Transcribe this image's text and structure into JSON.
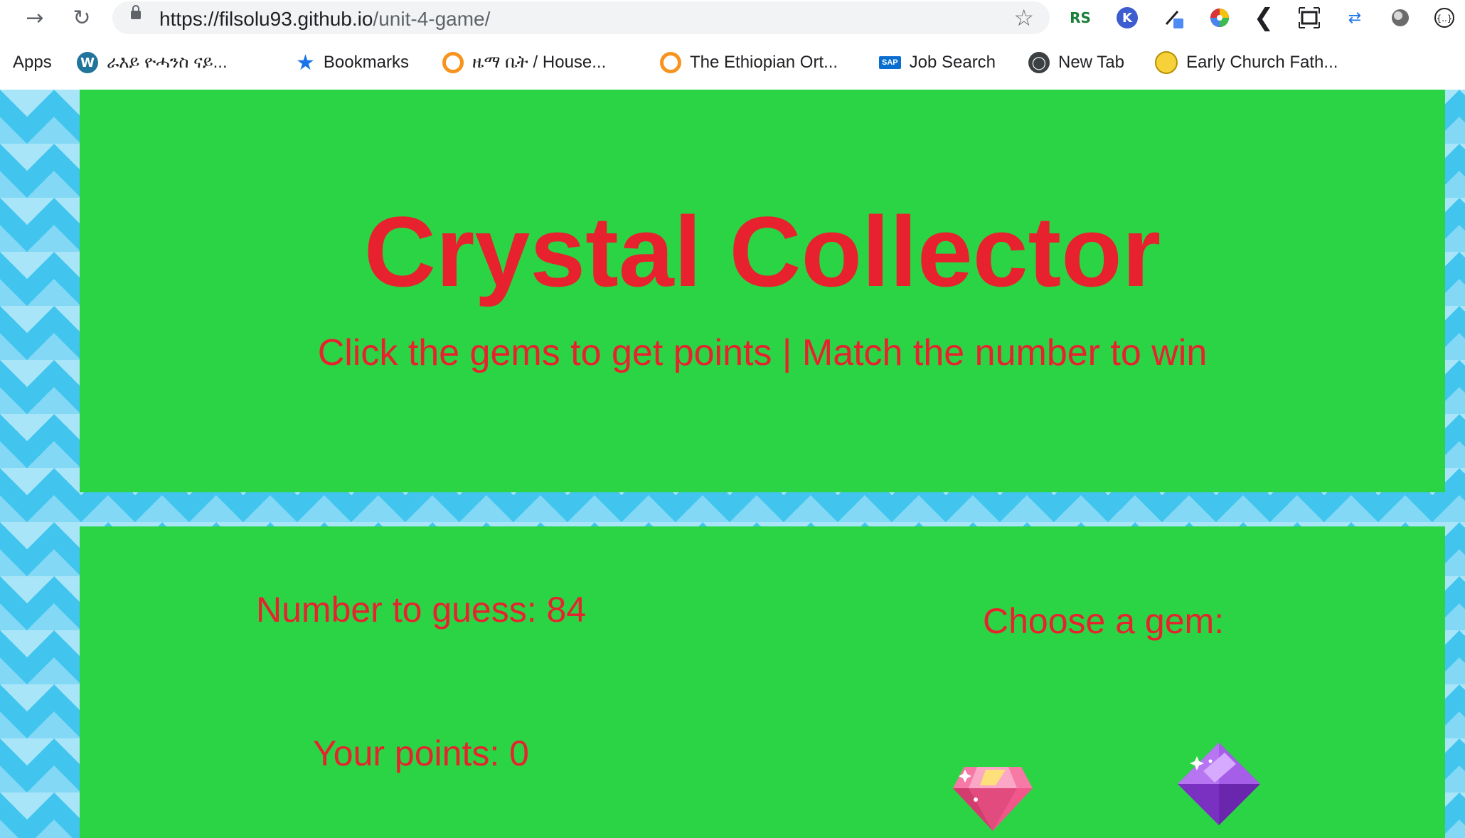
{
  "browser": {
    "url_host": "https://filsolu93.github.io",
    "url_path": "/unit-4-game/",
    "bookmarks": [
      {
        "label": "Apps"
      },
      {
        "label": "ራእይ ዮሓንስ ናይ..."
      },
      {
        "label": "Bookmarks"
      },
      {
        "label": "ዜማ ቤት / House..."
      },
      {
        "label": "The Ethiopian Ort..."
      },
      {
        "label": "Job Search"
      },
      {
        "label": "New Tab"
      },
      {
        "label": "Early Church Fath..."
      }
    ],
    "extensions": [
      "RS",
      "K"
    ]
  },
  "header": {
    "title": "Crystal Collector",
    "subtitle": "Click the gems to get points | Match the number to win"
  },
  "game": {
    "target_text": "Number to guess: 84",
    "points_text": "Your points: 0",
    "choose_text": "Choose a gem:",
    "gems": [
      "pink-diamond-gem",
      "purple-crystal-gem"
    ]
  },
  "colors": {
    "panel_green": "#2bd444",
    "text_red": "#e8212f",
    "background_blue": "#41c5ef"
  }
}
